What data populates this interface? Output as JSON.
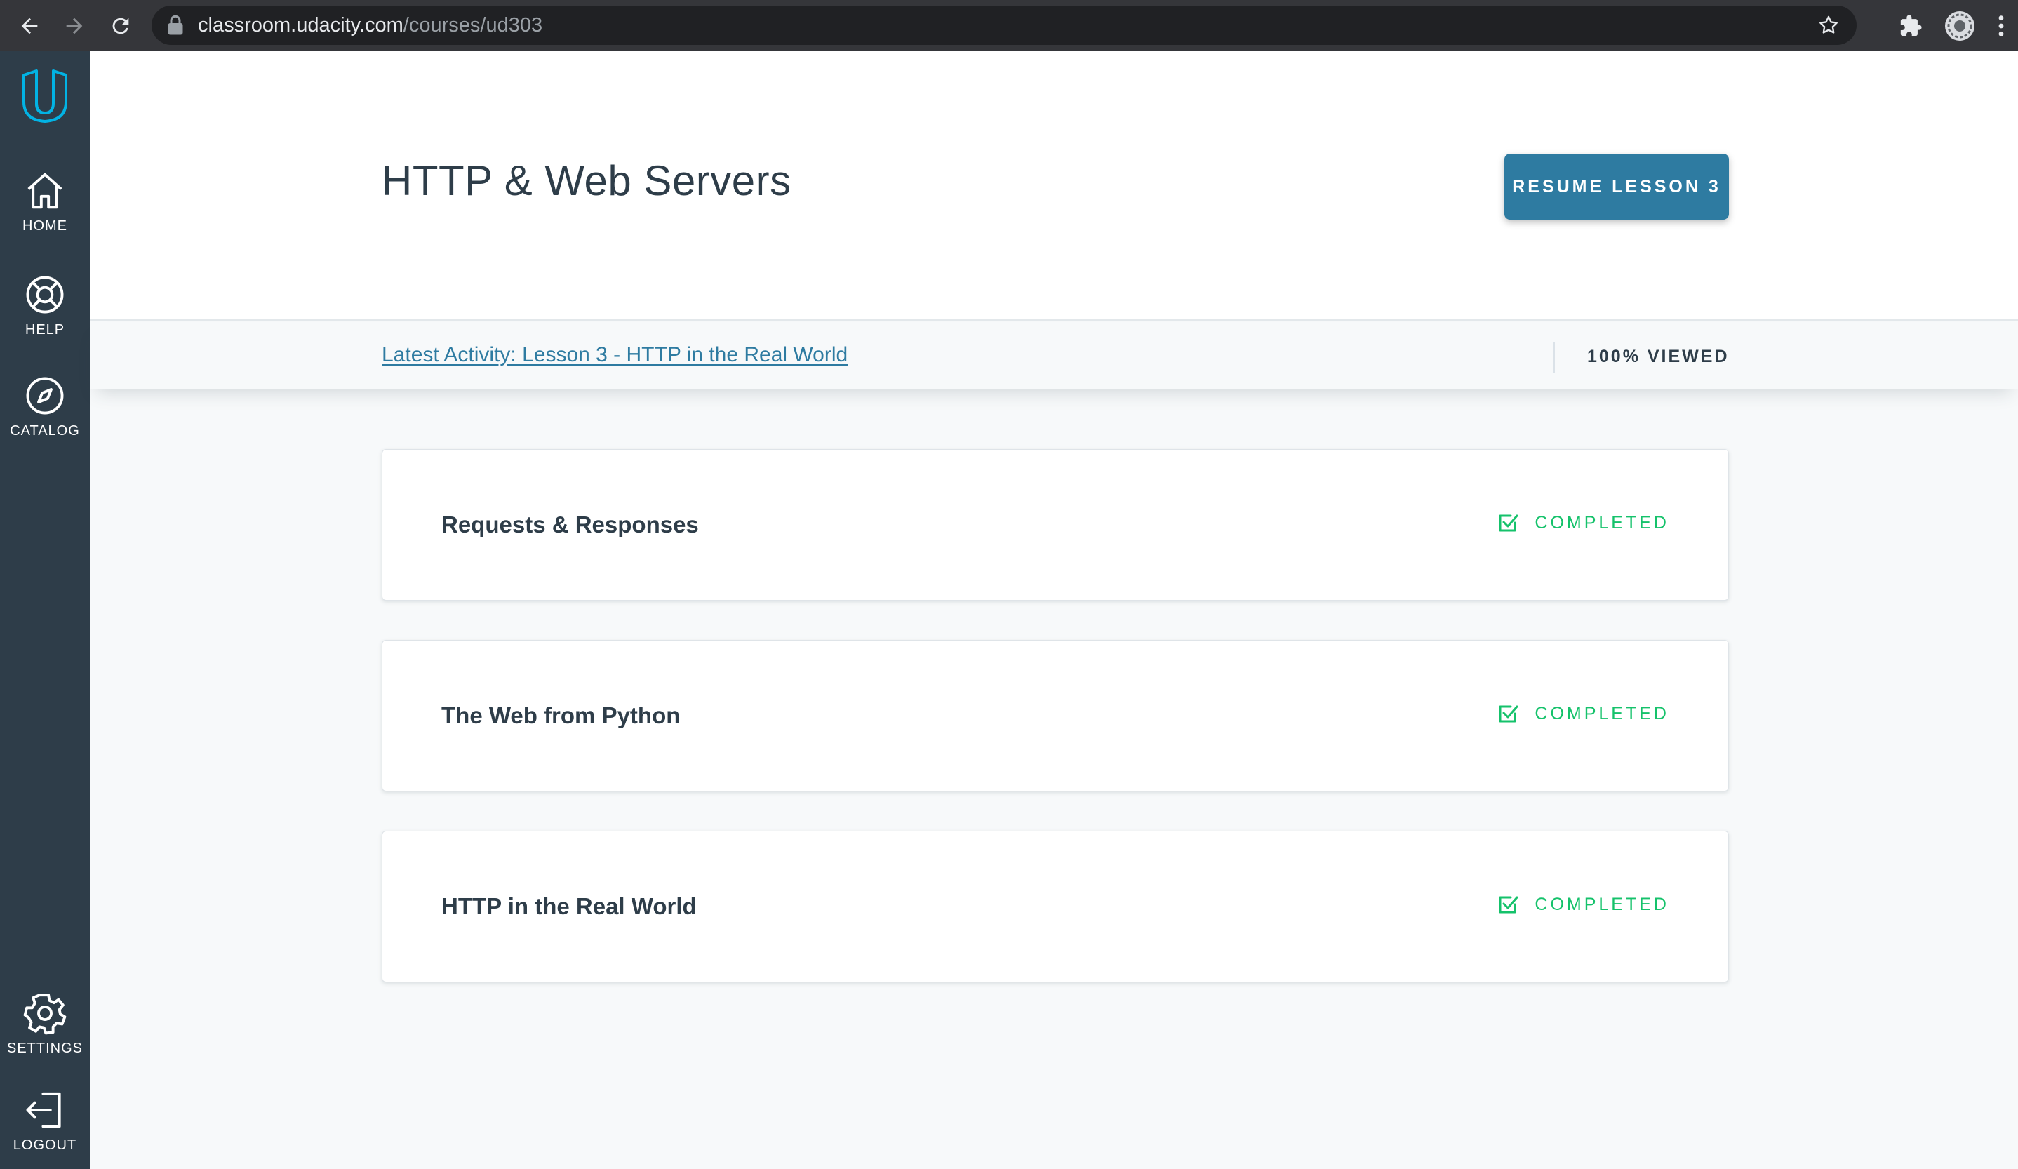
{
  "browser": {
    "url_host": "classroom.udacity.com",
    "url_path": "/courses/ud303"
  },
  "sidebar": {
    "items": [
      {
        "label": "HOME",
        "icon": "home-icon"
      },
      {
        "label": "HELP",
        "icon": "help-lifebuoy-icon"
      },
      {
        "label": "CATALOG",
        "icon": "compass-icon"
      },
      {
        "label": "SETTINGS",
        "icon": "gear-icon"
      },
      {
        "label": "LOGOUT",
        "icon": "logout-icon"
      }
    ]
  },
  "header": {
    "title": "HTTP & Web Servers",
    "resume_label": "RESUME LESSON 3"
  },
  "activity": {
    "link_text": "Latest Activity: Lesson 3 - HTTP in the Real World",
    "progress_text": "100% VIEWED"
  },
  "lessons": [
    {
      "title": "Requests & Responses",
      "status": "COMPLETED"
    },
    {
      "title": "The Web from Python",
      "status": "COMPLETED"
    },
    {
      "title": "HTTP in the Real World",
      "status": "COMPLETED"
    }
  ],
  "colors": {
    "sidebar_bg": "#2e3d49",
    "accent_blue": "#2e7ba1",
    "completed_green": "#15c26b",
    "text_dark": "#2e3d49"
  }
}
